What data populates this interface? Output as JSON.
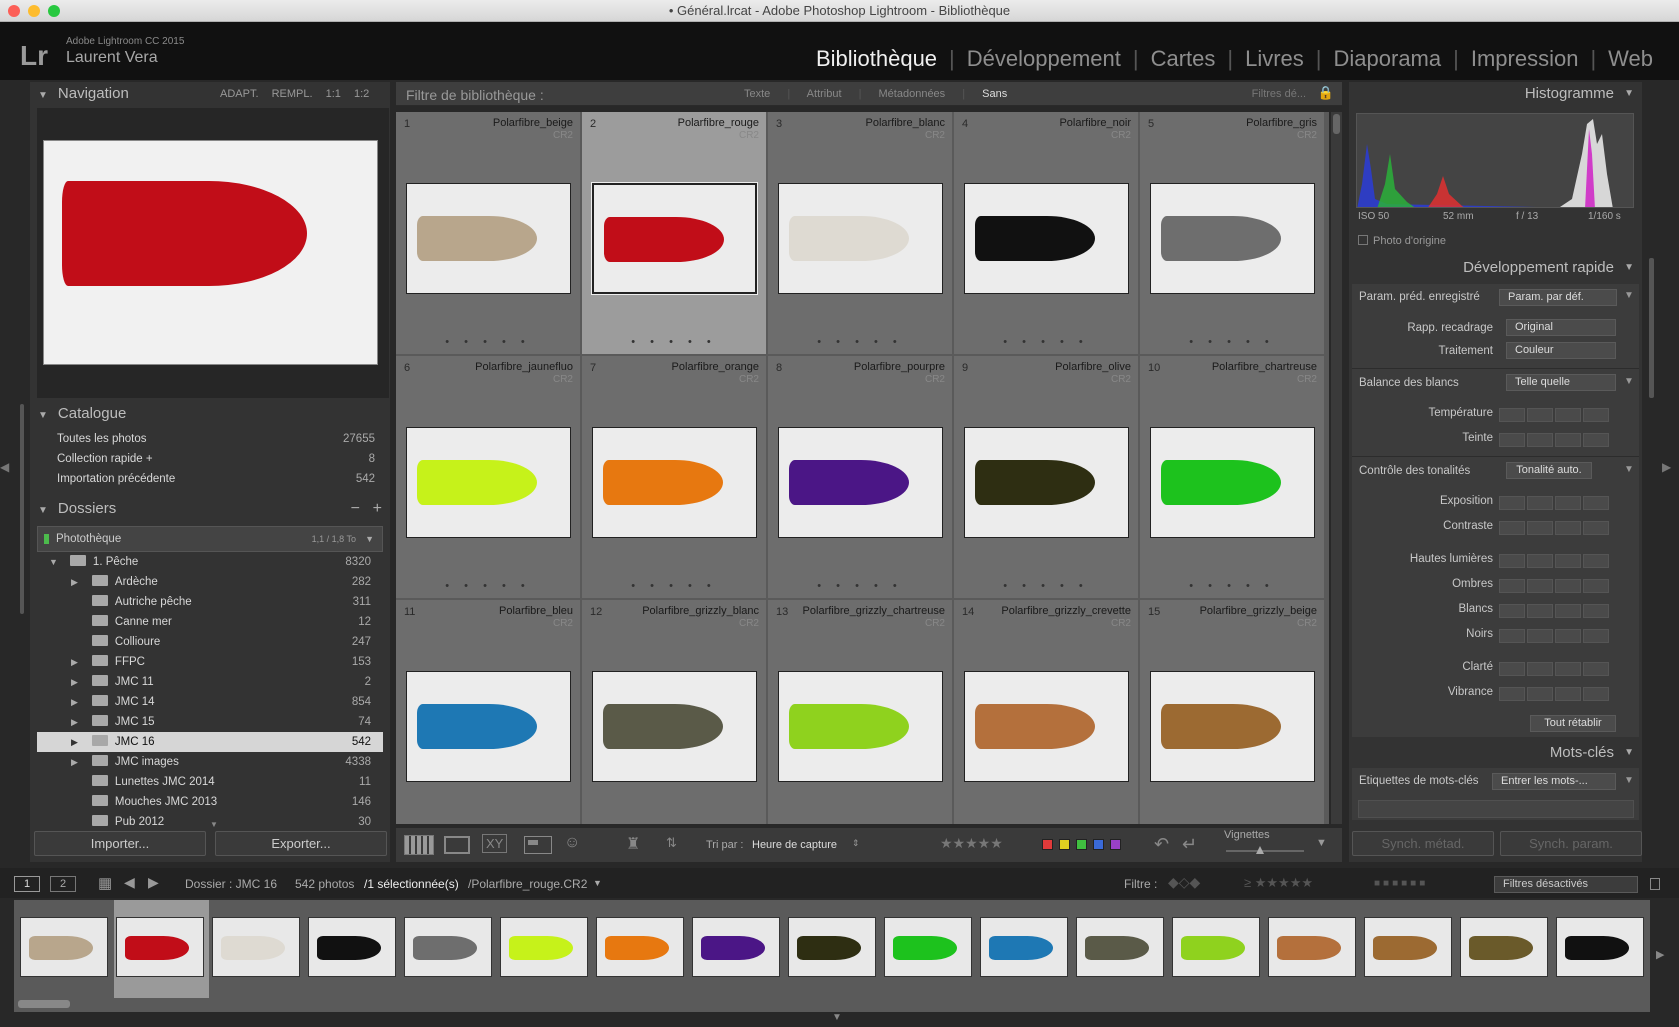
{
  "window": {
    "title": "• Général.lrcat - Adobe Photoshop Lightroom - Bibliothèque"
  },
  "identity": {
    "product": "Adobe Lightroom CC 2015",
    "user": "Laurent Vera"
  },
  "modules": [
    "Bibliothèque",
    "Développement",
    "Cartes",
    "Livres",
    "Diaporama",
    "Impression",
    "Web"
  ],
  "navigator": {
    "title": "Navigation",
    "zoom": [
      "ADAPT.",
      "REMPL.",
      "1:1",
      "1:2"
    ]
  },
  "catalog": {
    "title": "Catalogue",
    "items": [
      {
        "label": "Toutes les photos",
        "count": "27655"
      },
      {
        "label": "Collection rapide +",
        "count": "8"
      },
      {
        "label": "Importation précédente",
        "count": "542"
      }
    ]
  },
  "folders": {
    "title": "Dossiers",
    "volume": {
      "label": "Photothèque",
      "info": "1,1 / 1,8 To"
    },
    "root": {
      "label": "1. Pêche",
      "count": "8320"
    },
    "items": [
      {
        "label": "Ardèche",
        "count": "282",
        "expand": true
      },
      {
        "label": "Autriche pêche",
        "count": "311",
        "expand": false
      },
      {
        "label": "Canne mer",
        "count": "12",
        "expand": false
      },
      {
        "label": "Collioure",
        "count": "247",
        "expand": false
      },
      {
        "label": "FFPC",
        "count": "153",
        "expand": true
      },
      {
        "label": "JMC 11",
        "count": "2",
        "expand": true
      },
      {
        "label": "JMC 14",
        "count": "854",
        "expand": true
      },
      {
        "label": "JMC 15",
        "count": "74",
        "expand": true
      },
      {
        "label": "JMC 16",
        "count": "542",
        "expand": true,
        "selected": true
      },
      {
        "label": "JMC images",
        "count": "4338",
        "expand": true
      },
      {
        "label": "Lunettes JMC 2014",
        "count": "11",
        "expand": false
      },
      {
        "label": "Mouches JMC 2013",
        "count": "146",
        "expand": false
      },
      {
        "label": "Pub 2012",
        "count": "30",
        "expand": false
      }
    ]
  },
  "left_buttons": {
    "import": "Importer...",
    "export": "Exporter..."
  },
  "filter_bar": {
    "label": "Filtre de bibliothèque :",
    "tabs": [
      "Texte",
      "Attribut",
      "Métadonnées",
      "Sans"
    ],
    "preset": "Filtres dé..."
  },
  "grid": [
    {
      "n": "1",
      "name": "Polarfibre_beige",
      "ext": "CR2",
      "color": "#b8a68c"
    },
    {
      "n": "2",
      "name": "Polarfibre_rouge",
      "ext": "CR2",
      "color": "#c10d18",
      "selected": true
    },
    {
      "n": "3",
      "name": "Polarfibre_blanc",
      "ext": "CR2",
      "color": "#dedad2"
    },
    {
      "n": "4",
      "name": "Polarfibre_noir",
      "ext": "CR2",
      "color": "#111111"
    },
    {
      "n": "5",
      "name": "Polarfibre_gris",
      "ext": "CR2",
      "color": "#6e6e6e"
    },
    {
      "n": "6",
      "name": "Polarfibre_jaunefluo",
      "ext": "CR2",
      "color": "#c6f21a"
    },
    {
      "n": "7",
      "name": "Polarfibre_orange",
      "ext": "CR2",
      "color": "#e77810"
    },
    {
      "n": "8",
      "name": "Polarfibre_pourpre",
      "ext": "CR2",
      "color": "#4b1686"
    },
    {
      "n": "9",
      "name": "Polarfibre_olive",
      "ext": "CR2",
      "color": "#2e2e12"
    },
    {
      "n": "10",
      "name": "Polarfibre_chartreuse",
      "ext": "CR2",
      "color": "#1dc21d"
    },
    {
      "n": "11",
      "name": "Polarfibre_bleu",
      "ext": "CR2",
      "color": "#1e78b4"
    },
    {
      "n": "12",
      "name": "Polarfibre_grizzly_blanc",
      "ext": "CR2",
      "color": "#5a5a48"
    },
    {
      "n": "13",
      "name": "Polarfibre_grizzly_chartreuse",
      "ext": "CR2",
      "color": "#8fd21e"
    },
    {
      "n": "14",
      "name": "Polarfibre_grizzly_crevette",
      "ext": "CR2",
      "color": "#b4703c"
    },
    {
      "n": "15",
      "name": "Polarfibre_grizzly_beige",
      "ext": "CR2",
      "color": "#9c6a32"
    }
  ],
  "toolbar": {
    "sort_label": "Tri par :",
    "sort_value": "Heure de capture",
    "thumb_label": "Vignettes",
    "swatches": [
      "#e03a3a",
      "#e0d020",
      "#40c040",
      "#3a6ad8",
      "#9a40c8"
    ]
  },
  "histogram": {
    "title": "Histogramme",
    "iso": "ISO 50",
    "focal": "52 mm",
    "aperture": "f / 13",
    "shutter": "1/160 s",
    "original": "Photo d'origine"
  },
  "quick_develop": {
    "title": "Développement rapide",
    "preset_label": "Param. préd. enregistré",
    "preset_value": "Param. par déf.",
    "crop_label": "Rapp. recadrage",
    "crop_value": "Original",
    "treat_label": "Traitement",
    "treat_value": "Couleur",
    "wb_label": "Balance des blancs",
    "wb_value": "Telle quelle",
    "temp": "Température",
    "tint": "Teinte",
    "tone_label": "Contrôle des tonalités",
    "auto": "Tonalité auto.",
    "exposure": "Exposition",
    "contrast": "Contraste",
    "highlights": "Hautes lumières",
    "shadows": "Ombres",
    "whites": "Blancs",
    "blacks": "Noirs",
    "clarity": "Clarté",
    "vibrance": "Vibrance",
    "reset": "Tout rétablir"
  },
  "keywords": {
    "title": "Mots-clés",
    "label": "Etiquettes de mots-clés",
    "value": "Entrer les mots-..."
  },
  "sync": {
    "meta": "Synch. métad.",
    "param": "Synch. param."
  },
  "filmstrip_bar": {
    "source": "Dossier : JMC 16",
    "count": "542 photos",
    "selection": "/1 sélectionnée(s)",
    "file": "/Polarfibre_rouge.CR2",
    "filter_label": "Filtre :",
    "filter_value": "Filtres désactivés",
    "screen1": "1",
    "screen2": "2"
  },
  "filmstrip": [
    "#b8a68c",
    "#c10d18",
    "#dedad2",
    "#111111",
    "#6e6e6e",
    "#c6f21a",
    "#e77810",
    "#4b1686",
    "#2e2e12",
    "#1dc21d",
    "#1e78b4",
    "#5a5a48",
    "#8fd21e",
    "#b4703c",
    "#9c6a32",
    "#6a5a2a",
    "#111111"
  ]
}
